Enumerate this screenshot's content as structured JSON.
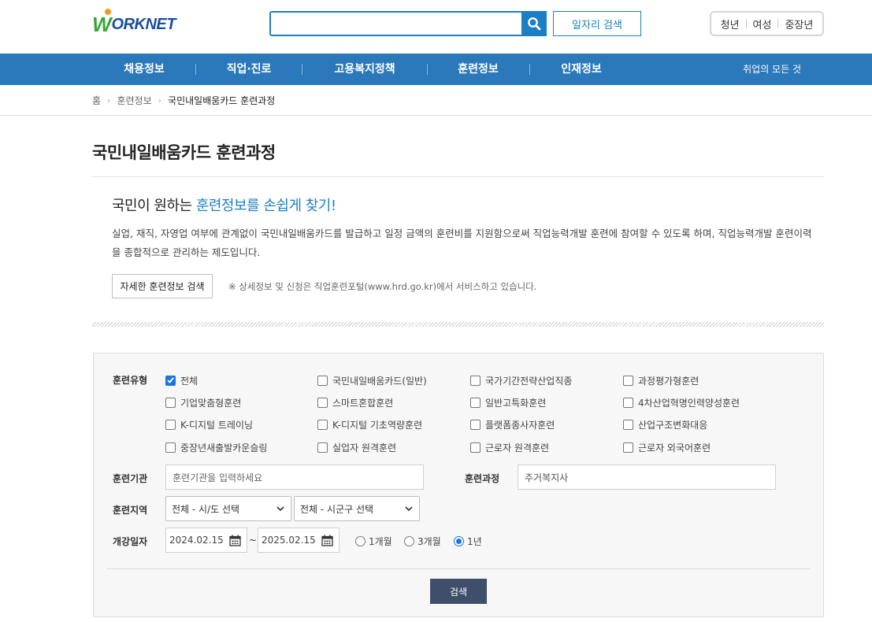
{
  "header": {
    "logo_w": "W",
    "logo_rest": "ORKNET",
    "search_placeholder": "",
    "job_search_button": "일자리 검색",
    "target_tabs": [
      "청년",
      "여성",
      "중장년"
    ]
  },
  "gnb": {
    "items": [
      "채용정보",
      "직업·진로",
      "고용복지정책",
      "훈련정보",
      "인재정보"
    ],
    "all_menu": "취업의 모든 것"
  },
  "breadcrumb": {
    "home": "홈",
    "level1": "훈련정보",
    "current": "국민내일배움카드 훈련과정"
  },
  "page": {
    "title": "국민내일배움카드 훈련과정",
    "intro_head_prefix": "국민이 원하는 ",
    "intro_head_highlight": "훈련정보를 손쉽게 찾기!",
    "intro_desc": "실업, 재직, 자영업 여부에 관계없이 국민내일배움카드를 발급하고 일정 금액의 훈련비를 지원함으로써 직업능력개발 훈련에 참여할 수 있도록 하며, 직업능력개발 훈련이력을 종합적으로 관리하는 제도입니다.",
    "detail_button": "자세한 훈련정보 검색",
    "notice": "※ 상세정보 및 신청은 직업훈련포털(www.hrd.go.kr)에서 서비스하고 있습니다."
  },
  "form": {
    "type_label": "훈련유형",
    "types": [
      {
        "label": "전체",
        "checked": true
      },
      {
        "label": "국민내일배움카드(일반)",
        "checked": false
      },
      {
        "label": "국가기간전략산업직종",
        "checked": false
      },
      {
        "label": "과정평가형훈련",
        "checked": false
      },
      {
        "label": "기업맞춤형훈련",
        "checked": false
      },
      {
        "label": "스마트혼합훈련",
        "checked": false
      },
      {
        "label": "일반고특화훈련",
        "checked": false
      },
      {
        "label": "4차산업혁명인력양성훈련",
        "checked": false
      },
      {
        "label": "K-디지털 트레이닝",
        "checked": false
      },
      {
        "label": "K-디지털 기초역량훈련",
        "checked": false
      },
      {
        "label": "플랫폼종사자훈련",
        "checked": false
      },
      {
        "label": "산업구조변화대응",
        "checked": false
      },
      {
        "label": "중장년새출발카운슬링",
        "checked": false
      },
      {
        "label": "실업자 원격훈련",
        "checked": false
      },
      {
        "label": "근로자 원격훈련",
        "checked": false
      },
      {
        "label": "근로자 외국어훈련",
        "checked": false
      }
    ],
    "org_label": "훈련기관",
    "org_placeholder": "훈련기관을 입력하세요",
    "course_label": "훈련과정",
    "course_value": "주거복지사",
    "region_label": "훈련지역",
    "region_sido": "전체 - 시/도 선택",
    "region_sigungu": "전체 - 시군구 선택",
    "date_label": "개강일자",
    "date_from": "2024.02.15",
    "date_sep": "~",
    "date_to": "2025.02.15",
    "periods": [
      {
        "label": "1개월",
        "checked": false
      },
      {
        "label": "3개월",
        "checked": false
      },
      {
        "label": "1년",
        "checked": true
      }
    ],
    "submit": "검색"
  },
  "colors": {
    "brand_blue": "#2b78bb",
    "accent_blue": "#1e7ec3",
    "submit_bg": "#3f4e6b"
  }
}
